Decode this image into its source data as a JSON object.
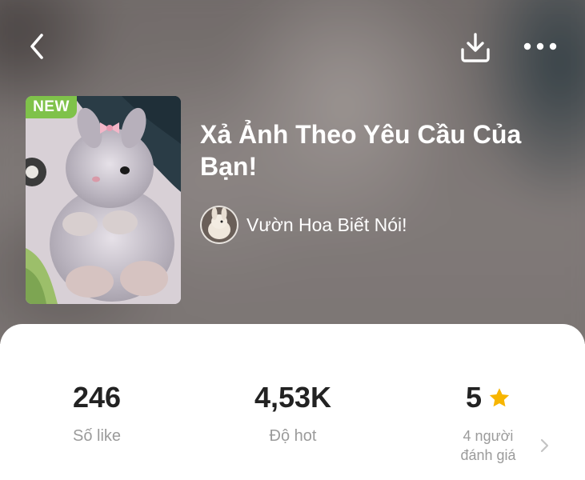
{
  "header": {
    "back_icon": "chevron-left-icon",
    "download_icon": "download-icon",
    "more_icon": "more-horizontal-icon"
  },
  "album": {
    "badge": "NEW",
    "title": "Xả Ảnh Theo Yêu Cầu Của Bạn!",
    "author": "Vườn Hoa Biết Nói!",
    "cover_description_icon": "bunny-cover-image"
  },
  "stats": {
    "likes": {
      "value": "246",
      "label": "Số like"
    },
    "hot": {
      "value": "4,53K",
      "label": "Độ hot"
    },
    "rating": {
      "value": "5",
      "label_line1": "4 người",
      "label_line2": "đánh giá",
      "star_icon": "star-icon"
    }
  },
  "colors": {
    "badge_green": "#7fc24a",
    "star_yellow": "#f7b500",
    "text_dark": "#222222",
    "text_muted": "#9b9b9b"
  }
}
